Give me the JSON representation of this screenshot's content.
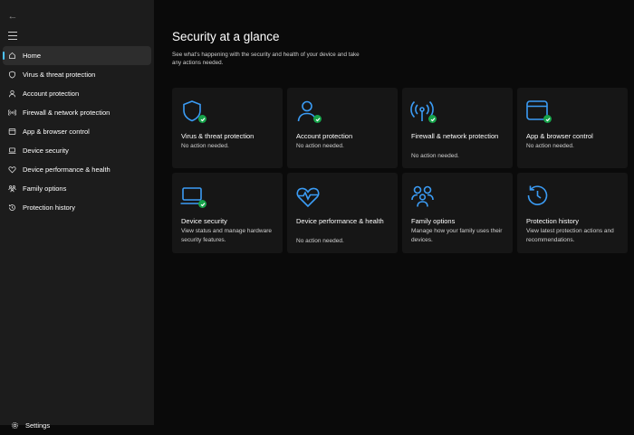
{
  "sidebar": {
    "back_glyph": "←",
    "nav": [
      {
        "label": "Home",
        "icon": "home-icon",
        "active": true
      },
      {
        "label": "Virus & threat protection",
        "icon": "shield-icon"
      },
      {
        "label": "Account protection",
        "icon": "person-icon"
      },
      {
        "label": "Firewall & network protection",
        "icon": "wifi-icon"
      },
      {
        "label": "App & browser control",
        "icon": "app-window-icon"
      },
      {
        "label": "Device security",
        "icon": "laptop-icon"
      },
      {
        "label": "Device performance & health",
        "icon": "heart-icon"
      },
      {
        "label": "Family options",
        "icon": "family-icon"
      },
      {
        "label": "Protection history",
        "icon": "history-icon"
      }
    ],
    "settings_label": "Settings"
  },
  "main": {
    "title": "Security at a glance",
    "subtitle": "See what's happening with the security and health of your device and take any actions needed.",
    "cards": [
      {
        "title": "Virus & threat protection",
        "desc": "No action needed.",
        "icon": "shield-icon",
        "status": "ok"
      },
      {
        "title": "Account protection",
        "desc": "No action needed.",
        "icon": "person-icon",
        "status": "ok"
      },
      {
        "title": "Firewall & network protection",
        "desc": "No action needed.",
        "icon": "wifi-icon",
        "status": "ok"
      },
      {
        "title": "App & browser control",
        "desc": "No action needed.",
        "icon": "app-window-icon",
        "status": "ok"
      },
      {
        "title": "Device security",
        "desc": "View status and manage hardware security features.",
        "icon": "laptop-icon",
        "status": "ok"
      },
      {
        "title": "Device performance & health",
        "desc": "No action needed.",
        "icon": "heartbeat-icon"
      },
      {
        "title": "Family options",
        "desc": "Manage how your family uses their devices.",
        "icon": "family-icon"
      },
      {
        "title": "Protection history",
        "desc": "View latest protection actions and recommendations.",
        "icon": "history-icon"
      }
    ]
  },
  "colors": {
    "accent": "#4cc2ff",
    "icon_blue": "#3b9cf5",
    "ok_green": "#16a34a"
  }
}
